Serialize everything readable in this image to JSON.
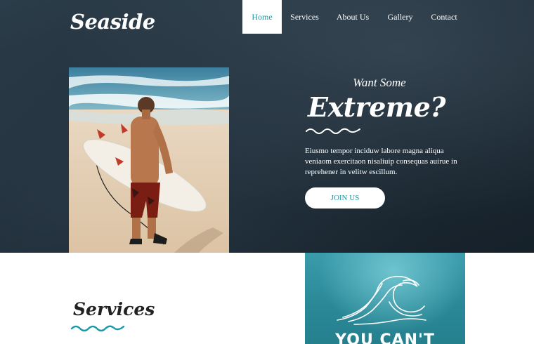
{
  "brand": {
    "logo_text": "Seaside"
  },
  "nav": {
    "items": [
      {
        "label": "Home",
        "active": true
      },
      {
        "label": "Services",
        "active": false
      },
      {
        "label": "About Us",
        "active": false
      },
      {
        "label": "Gallery",
        "active": false
      },
      {
        "label": "Contact",
        "active": false
      }
    ]
  },
  "hero": {
    "tagline": "Want Some",
    "headline": "Extreme?",
    "text": "Eiusmo tempor inciduw labore magna aliqua veniaom exercitaon nisaliuip consequas auirue in reprehener in velitw escillum.",
    "button_label": "JOIN US"
  },
  "services": {
    "title": "Services"
  },
  "promo": {
    "text": "YOU CAN'T"
  },
  "colors": {
    "accent": "#1a9aa6",
    "hero_dark": "#1e2c37",
    "wave_white": "#ffffff"
  }
}
